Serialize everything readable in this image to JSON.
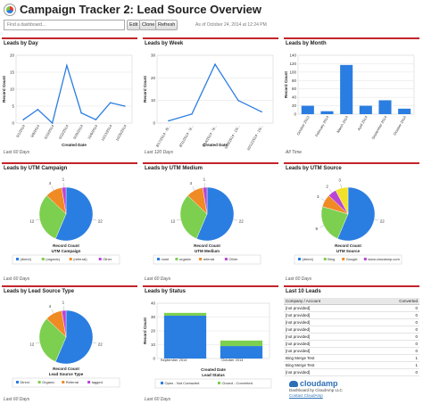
{
  "header": {
    "title": "Campaign Tracker 2: Lead Source Overview",
    "search_placeholder": "Find a dashboard...",
    "edit_label": "Edit",
    "clone_label": "Clone",
    "refresh_label": "Refresh",
    "as_of": "As of October 24, 2014 at 12:24 PM"
  },
  "panels": {
    "leads_by_day": {
      "title": "Leads by Day",
      "footer": "Last 60 Days"
    },
    "leads_by_week": {
      "title": "Leads by Week",
      "footer": "Last 120 Days"
    },
    "leads_by_month": {
      "title": "Leads by Month",
      "footer": "All Time"
    },
    "utm_campaign": {
      "title": "Leads by UTM Campaign",
      "footer": "Last 60 Days"
    },
    "utm_medium": {
      "title": "Leads by UTM Medium",
      "footer": "Last 60 Days"
    },
    "utm_source": {
      "title": "Leads by UTM Source",
      "footer": "Last 60 Days"
    },
    "lead_source_type": {
      "title": "Leads by Lead Source Type",
      "footer": "Last 60 Days"
    },
    "by_status": {
      "title": "Leads by Status",
      "footer": "Last 60 Days"
    },
    "last_10": {
      "title": "Last 10 Leads"
    }
  },
  "chart_data": [
    {
      "id": "leads_by_day",
      "type": "line",
      "categories": [
        "9/1/2014",
        "9/8/2014",
        "9/15/2014",
        "9/22/2014",
        "9/29/2014",
        "10/6/2014",
        "10/13/2014",
        "10/20/2014"
      ],
      "values": [
        1,
        4,
        0,
        17,
        3,
        1,
        6,
        5
      ],
      "xlabel": "Created Date",
      "ylabel": "Record Count",
      "ylim": [
        0,
        20
      ],
      "yticks": [
        "0",
        "5",
        "10",
        "15",
        "20"
      ],
      "color": "#2a7de1"
    },
    {
      "id": "leads_by_week",
      "type": "line",
      "categories": [
        "8/17/2014 - 8/...",
        "8/31/2014 - 9/...",
        "9/14/2014 - 9/...",
        "9/28/2014 - 10/...",
        "10/12/2014 - 10/..."
      ],
      "values": [
        1,
        4,
        26,
        10,
        5
      ],
      "xlabel": "Created Date",
      "ylabel": "Record Count",
      "ylim": [
        0,
        30
      ],
      "yticks": [
        "0",
        "10",
        "20",
        "30"
      ],
      "color": "#2a7de1"
    },
    {
      "id": "leads_by_month",
      "type": "bar",
      "categories": [
        "October 2013",
        "February 2014",
        "March 2014",
        "April 2014",
        "September 2014",
        "October 2014"
      ],
      "values": [
        20,
        7,
        117,
        20,
        33,
        13
      ],
      "xlabel": "",
      "ylabel": "Record Count",
      "ylim": [
        0,
        140
      ],
      "yticks": [
        "0",
        "20",
        "40",
        "60",
        "80",
        "100",
        "120",
        "140"
      ],
      "color": "#2a7de1"
    },
    {
      "id": "utm_campaign",
      "type": "pie",
      "center_label": "Record Count",
      "legend_title": "UTM Campaign",
      "slices": [
        {
          "label": "(direct)",
          "value": 22,
          "color": "#2a7de1"
        },
        {
          "label": "(organic)",
          "value": 12,
          "color": "#7ccf4f"
        },
        {
          "label": "(referral)",
          "value": 4,
          "color": "#f08a24"
        },
        {
          "label": "Other",
          "value": 1,
          "color": "#b945d6"
        }
      ],
      "outer_labels": [
        "22",
        "12",
        "4",
        "1"
      ]
    },
    {
      "id": "utm_medium",
      "type": "pie",
      "center_label": "Record Count",
      "legend_title": "UTM Medium",
      "slices": [
        {
          "label": "none",
          "value": 22,
          "color": "#2a7de1"
        },
        {
          "label": "organic",
          "value": 12,
          "color": "#7ccf4f"
        },
        {
          "label": "referral",
          "value": 4,
          "color": "#f08a24"
        },
        {
          "label": "Other",
          "value": 1,
          "color": "#b945d6"
        }
      ],
      "outer_labels": [
        "22",
        "12",
        "4",
        "1"
      ]
    },
    {
      "id": "utm_source",
      "type": "pie",
      "center_label": "Record Count",
      "legend_title": "UTM Source",
      "slices": [
        {
          "label": "(direct)",
          "value": 22,
          "color": "#2a7de1"
        },
        {
          "label": "Bing",
          "value": 9,
          "color": "#7ccf4f"
        },
        {
          "label": "Google",
          "value": 3,
          "color": "#f08a24"
        },
        {
          "label": "www.cloudamp.com",
          "value": 2,
          "color": "#b945d6"
        },
        {
          "label": "",
          "value": 3,
          "color": "#f1e12a"
        }
      ],
      "outer_labels": [
        "22",
        "9",
        "3",
        "2",
        "3"
      ]
    },
    {
      "id": "lead_source_type",
      "type": "pie",
      "center_label": "Record Count",
      "legend_title": "Lead Source Type",
      "slices": [
        {
          "label": "Direct",
          "value": 22,
          "color": "#2a7de1"
        },
        {
          "label": "Organic",
          "value": 12,
          "color": "#7ccf4f"
        },
        {
          "label": "Referral",
          "value": 4,
          "color": "#f08a24"
        },
        {
          "label": "tagged",
          "value": 1,
          "color": "#b945d6"
        }
      ],
      "outer_labels": [
        "22",
        "12",
        "4",
        "1"
      ]
    },
    {
      "id": "by_status",
      "type": "bar",
      "categories": [
        "September 2014",
        "October 2014"
      ],
      "series": [
        {
          "name": "Open - Not Contacted",
          "values": [
            31,
            9
          ],
          "color": "#2a7de1"
        },
        {
          "name": "Closed - Converted",
          "values": [
            2,
            4
          ],
          "color": "#7ccf4f"
        }
      ],
      "xlabel": "Created Date",
      "ylabel": "Record Count",
      "ylim": [
        0,
        40
      ],
      "yticks": [
        "0",
        "10",
        "20",
        "30",
        "40"
      ],
      "legend_title": "Lead Status"
    }
  ],
  "last_10": {
    "col1": "Company / Account",
    "col2": "Converted",
    "rows": [
      [
        "[not provided]",
        "0"
      ],
      [
        "[not provided]",
        "0"
      ],
      [
        "[not provided]",
        "0"
      ],
      [
        "[not provided]",
        "0"
      ],
      [
        "[not provided]",
        "0"
      ],
      [
        "[not provided]",
        "0"
      ],
      [
        "[not provided]",
        "0"
      ],
      [
        "Bing Merge Test",
        "1"
      ],
      [
        "Bing Merge Test",
        "1"
      ],
      [
        "[not provided]",
        "0"
      ]
    ],
    "brand": "cloudamp",
    "line1": "Dashboard by CloudAmp LLC",
    "line2": "Contact CloudAmp"
  }
}
